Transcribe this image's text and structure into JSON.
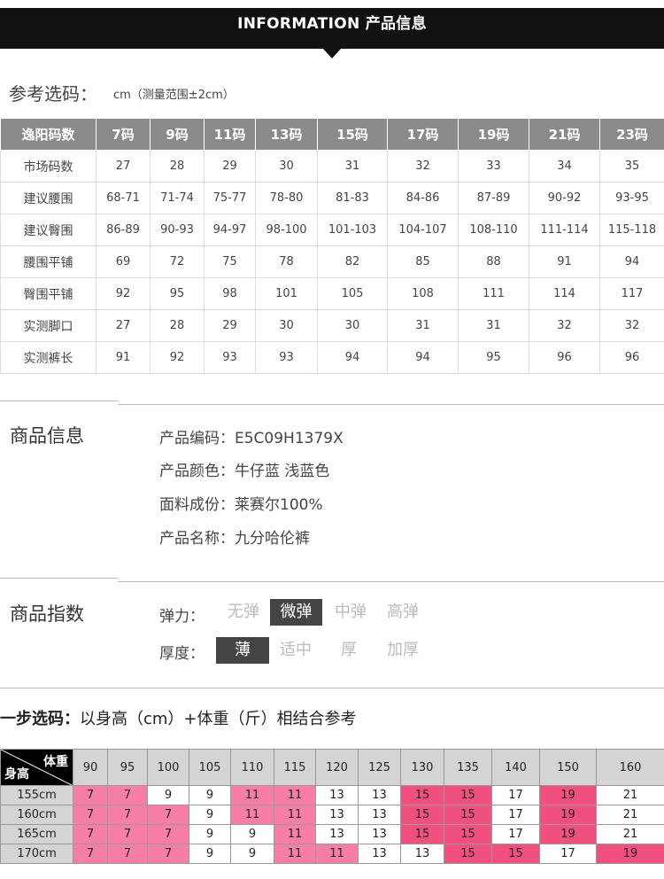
{
  "banner": {
    "title": "INFORMATION 产品信息"
  },
  "reference": {
    "title": "参考选码：",
    "note": "cm（测量范围±2cm）"
  },
  "size_table": {
    "headers": [
      "逸阳码数",
      "7码",
      "9码",
      "11码",
      "13码",
      "15码",
      "17码",
      "19码",
      "21码",
      "23码"
    ],
    "rows": [
      [
        "市场码数",
        "27",
        "28",
        "29",
        "30",
        "31",
        "32",
        "33",
        "34",
        "35"
      ],
      [
        "建议腰围",
        "68-71",
        "71-74",
        "75-77",
        "78-80",
        "81-83",
        "84-86",
        "87-89",
        "90-92",
        "93-95"
      ],
      [
        "建议臀围",
        "86-89",
        "90-93",
        "94-97",
        "98-100",
        "101-103",
        "104-107",
        "108-110",
        "111-114",
        "115-118"
      ],
      [
        "腰围平铺",
        "69",
        "72",
        "75",
        "78",
        "82",
        "85",
        "88",
        "91",
        "94"
      ],
      [
        "臀围平铺",
        "92",
        "95",
        "98",
        "101",
        "105",
        "108",
        "111",
        "114",
        "117"
      ],
      [
        "实测脚口",
        "27",
        "28",
        "29",
        "30",
        "30",
        "31",
        "31",
        "32",
        "32"
      ],
      [
        "实测裤长",
        "91",
        "92",
        "93",
        "93",
        "94",
        "94",
        "95",
        "96",
        "96"
      ]
    ]
  },
  "product_info": {
    "title": "商品信息",
    "code": "产品编码：E5C09H1379X",
    "color": "产品颜色：牛仔蓝 浅蓝色",
    "fabric": "面料成份：莱赛尔100%",
    "name": "产品名称：九分哈伦裤"
  },
  "product_index": {
    "title": "商品指数",
    "elasticity": {
      "label": "弹力：",
      "options": [
        "无弹",
        "微弹",
        "中弹",
        "高弹"
      ],
      "selected": "微弹"
    },
    "thickness": {
      "label": "厚度：",
      "options": [
        "薄",
        "适中",
        "厚",
        "加厚"
      ],
      "selected": "薄"
    }
  },
  "step": {
    "title_bold": "一步选码：",
    "title_rest": "以身高（cm）+体重（斤）相结合参考"
  },
  "hw_table": {
    "corner_weight": "体重",
    "corner_height": "身高",
    "weights": [
      "90",
      "95",
      "100",
      "105",
      "110",
      "115",
      "120",
      "125",
      "130",
      "135",
      "140",
      "150",
      "160"
    ],
    "rows": [
      {
        "height": "155cm",
        "values": [
          "7",
          "7",
          "9",
          "9",
          "11",
          "11",
          "13",
          "13",
          "15",
          "15",
          "17",
          "19",
          "21"
        ]
      },
      {
        "height": "160cm",
        "values": [
          "7",
          "7",
          "7",
          "9",
          "11",
          "11",
          "13",
          "13",
          "15",
          "15",
          "17",
          "19",
          "21"
        ]
      },
      {
        "height": "165cm",
        "values": [
          "7",
          "7",
          "7",
          "9",
          "9",
          "11",
          "13",
          "13",
          "15",
          "15",
          "17",
          "19",
          "21"
        ]
      },
      {
        "height": "170cm",
        "values": [
          "7",
          "7",
          "7",
          "9",
          "9",
          "11",
          "11",
          "13",
          "13",
          "15",
          "15",
          "17",
          "19"
        ]
      }
    ],
    "colors": {
      "7": "#f77ea4",
      "9": "#ffffff",
      "11": "#f77ea4",
      "13": "#ffffff",
      "15": "#f0507f",
      "17": "#ffffff",
      "19": "#f0507f",
      "21": "#ffffff"
    }
  }
}
